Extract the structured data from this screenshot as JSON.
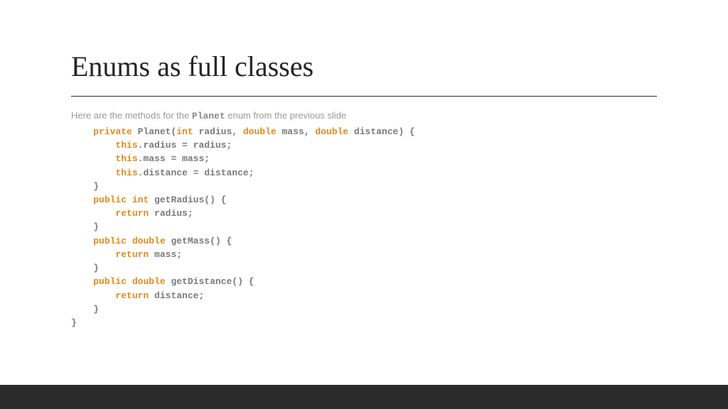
{
  "title": "Enums as full classes",
  "intro_prefix": "Here are the methods for the ",
  "intro_strong": "Planet",
  "intro_suffix": " enum from the previous slide",
  "code": {
    "l01_a": "    ",
    "l01_kw1": "private",
    "l01_b": " Planet(",
    "l01_kw2": "int",
    "l01_c": " radius, ",
    "l01_kw3": "double",
    "l01_d": " mass, ",
    "l01_kw4": "double",
    "l01_e": " distance) {",
    "l02_a": "        ",
    "l02_kw": "this",
    "l02_b": ".radius = radius;",
    "l03_a": "        ",
    "l03_kw": "this",
    "l03_b": ".mass = mass;",
    "l04_a": "        ",
    "l04_kw": "this",
    "l04_b": ".distance = distance;",
    "l05": "    }",
    "l06_a": "    ",
    "l06_kw1": "public",
    "l06_b": " ",
    "l06_kw2": "int",
    "l06_c": " getRadius() {",
    "l07_a": "        ",
    "l07_kw": "return",
    "l07_b": " radius;",
    "l08": "    }",
    "l09_a": "    ",
    "l09_kw1": "public",
    "l09_b": " ",
    "l09_kw2": "double",
    "l09_c": " getMass() {",
    "l10_a": "        ",
    "l10_kw": "return",
    "l10_b": " mass;",
    "l11": "    }",
    "l12_a": "    ",
    "l12_kw1": "public",
    "l12_b": " ",
    "l12_kw2": "double",
    "l12_c": " getDistance() {",
    "l13_a": "        ",
    "l13_kw": "return",
    "l13_b": " distance;",
    "l14": "    }",
    "l15": "}"
  }
}
